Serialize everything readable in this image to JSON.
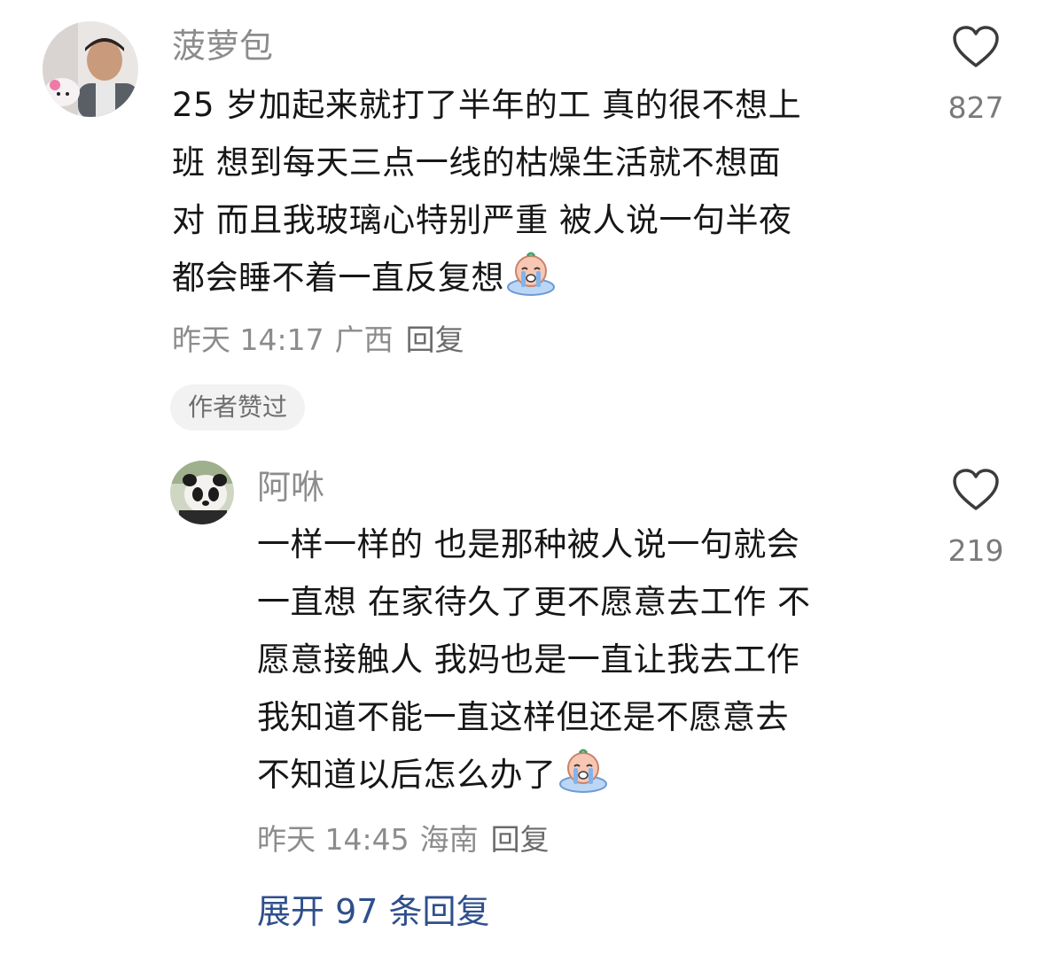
{
  "comments": [
    {
      "username": "菠萝包",
      "lines": [
        "25 岁加起来就打了半年的工 真的很不想上",
        "班 想到每天三点一线的枯燥生活就不想面",
        "对 而且我玻璃心特别严重 被人说一句半夜",
        "都会睡不着一直反复想"
      ],
      "emoji": "crying-emoji",
      "time": "昨天 14:17",
      "location": "广西",
      "reply_label": "回复",
      "badge": "作者赞过",
      "likes": "827"
    },
    {
      "username": "阿咻",
      "lines": [
        "一样一样的 也是那种被人说一句就会",
        "一直想 在家待久了更不愿意去工作 不",
        "愿意接触人 我妈也是一直让我去工作",
        "我知道不能一直这样但还是不愿意去",
        "不知道以后怎么办了"
      ],
      "emoji": "crying-emoji",
      "time": "昨天 14:45",
      "location": "海南",
      "reply_label": "回复",
      "likes": "219"
    }
  ],
  "expand_replies": "展开 97 条回复",
  "colors": {
    "text": "#161616",
    "muted": "#8c8c8c",
    "link": "#2f4f8c",
    "badge_bg": "#f2f2f2"
  }
}
